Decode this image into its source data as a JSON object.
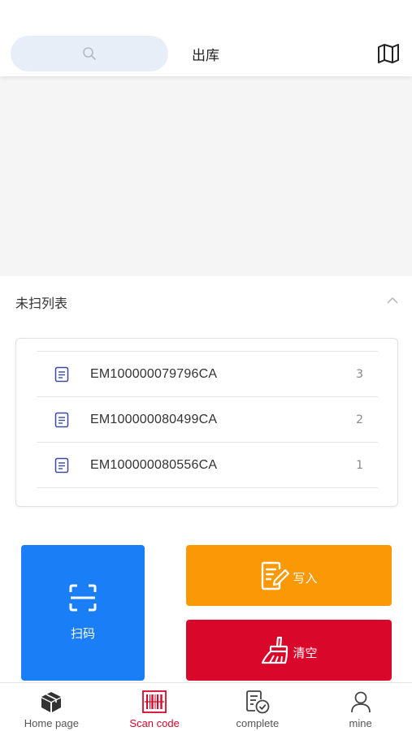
{
  "header": {
    "search_icon": "search-icon",
    "title": "出库",
    "map_icon": "map-icon"
  },
  "list": {
    "title": "未扫列表",
    "collapse_icon": "chevron-up-icon",
    "items": [
      {
        "code": "EM100000079796CA",
        "index": "3",
        "icon": "document-icon"
      },
      {
        "code": "EM100000080499CA",
        "index": "2",
        "icon": "document-icon"
      },
      {
        "code": "EM100000080556CA",
        "index": "1",
        "icon": "document-icon"
      }
    ]
  },
  "actions": {
    "scan_label": "扫码",
    "write_label": "写入",
    "clear_label": "清空",
    "scan_color": "#1a7ef7",
    "write_color": "#fa9805",
    "clear_color": "#d9072a"
  },
  "tabbar": {
    "active_color": "#d9072a",
    "tabs": [
      {
        "label": "Home page",
        "icon": "box-icon"
      },
      {
        "label": "Scan code",
        "icon": "barcode-icon",
        "active": true
      },
      {
        "label": "complete",
        "icon": "checklist-icon"
      },
      {
        "label": "mine",
        "icon": "user-icon"
      }
    ]
  }
}
